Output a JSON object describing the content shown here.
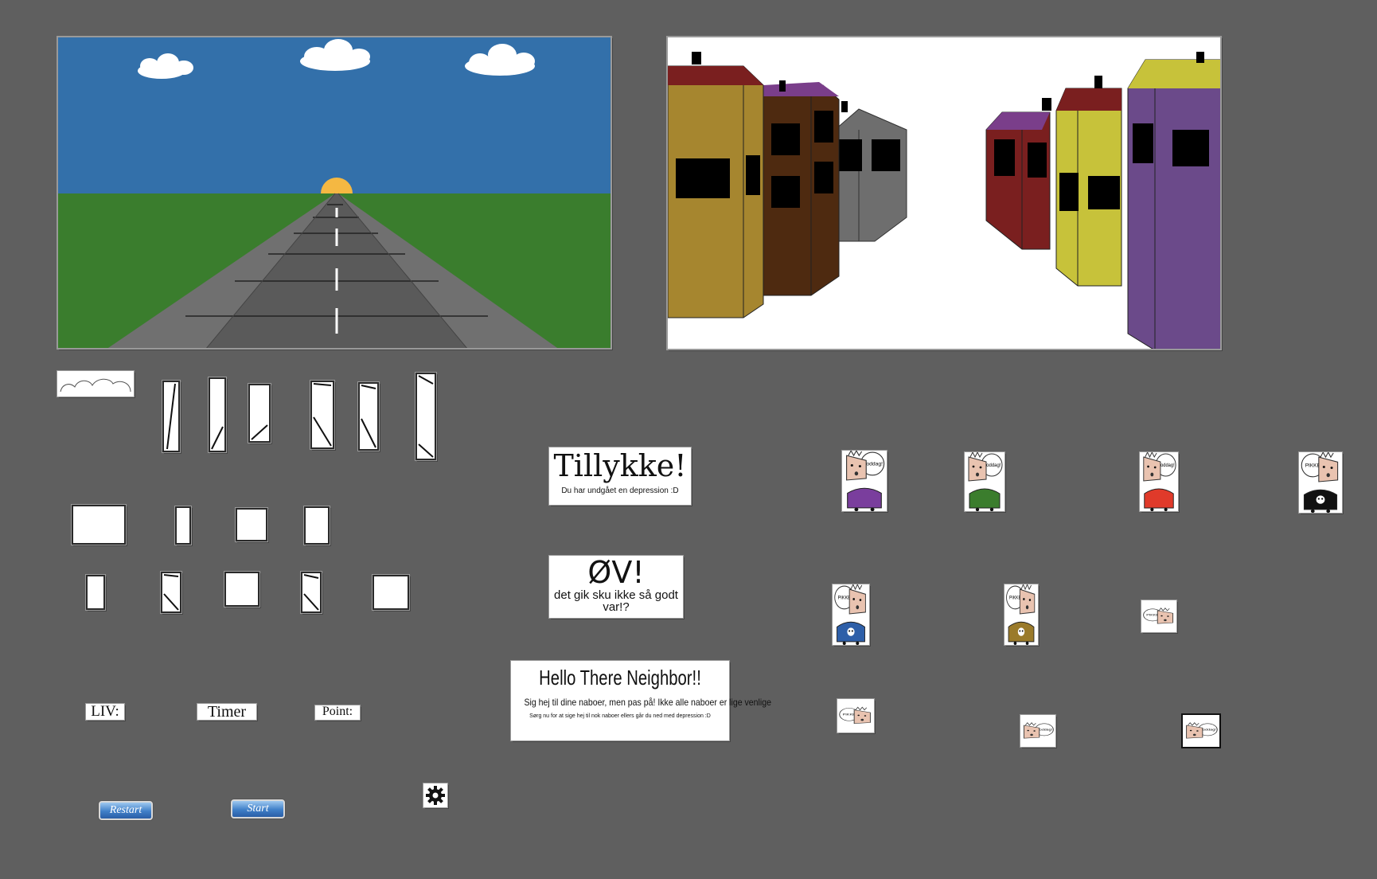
{
  "scenes": {
    "road": {
      "sky": "#3370aa",
      "grass": "#3a7d2d",
      "sun": "#f5b842",
      "road": "#5a5a5a",
      "sidewalk": "#707070"
    },
    "street": {
      "background": "#ffffff"
    }
  },
  "panels": {
    "tillykke": {
      "title": "Tillykke!",
      "subtitle": "Du har undgået en depression :D"
    },
    "ov": {
      "title": "ØV!",
      "subtitle": "det gik sku ikke så godt var!?"
    },
    "hello": {
      "title": "Hello There Neighbor!!",
      "line1": "Sig hej til dine naboer, men pas på! Ikke alle naboer er lige venlige",
      "line2": "Sørg nu for at sige hej til nok naboer ellers går du ned med depression :D"
    }
  },
  "hud": {
    "lives_label": "LIV:",
    "timer_label": "Timer",
    "points_label": "Point:"
  },
  "buttons": {
    "restart": "Restart",
    "start": "Start"
  },
  "icons": {
    "settings": "gear-icon"
  },
  "npcs": {
    "greeting_friendly": "Goddag!",
    "greeting_hostile": "PIKKE",
    "shirt_colors": [
      "#7a3e9d",
      "#3b7d2d",
      "#e03a2a",
      "#111111",
      "#2e5fa8",
      "#9a7a2a"
    ]
  }
}
